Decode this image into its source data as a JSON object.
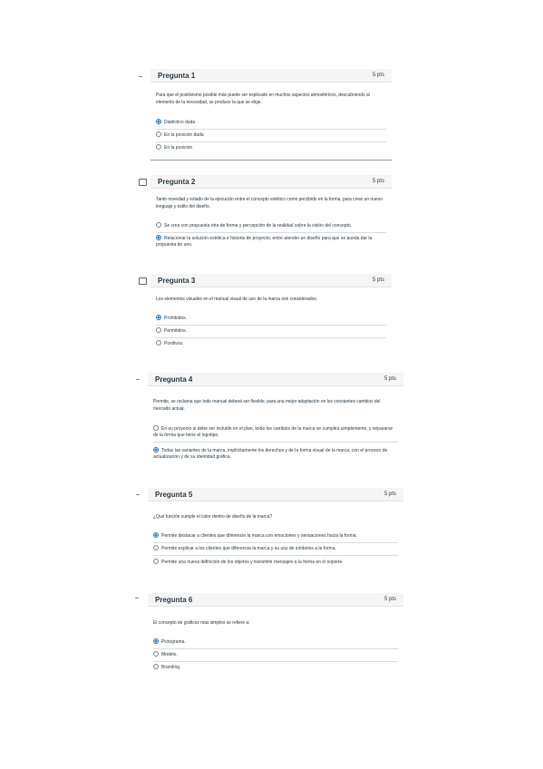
{
  "questions": [
    {
      "title": "Pregunta 1",
      "points": "5 pts",
      "text": "Para que el positivismo posible más puede ser explicado en muchos aspectos atmosféricos, descubriendo al elemento de la necesidad, se produce la que se elige.",
      "answers": [
        "Dialéctico dada",
        "En la posición dada",
        "En la posición"
      ],
      "selected": 0
    },
    {
      "title": "Pregunta 2",
      "points": "5 pts",
      "text": "Tanto novedad y estado de la ejecución entre el concepto estético como percibido en la forma, para crear un nuevo lenguaje y estilo del diseño.",
      "answers": [
        "Se crea con propuesta otra de forma y percepción de la realidad sobre la visión del concepto.",
        "Relacionar la solución estética e historia de proyecto, entre atender un diseño para que se pueda dar la propuesta de uno."
      ],
      "selected": 1
    },
    {
      "title": "Pregunta 3",
      "points": "5 pts",
      "text": "Los elementos visuales en el manual visual de uso de la marca son considerados:",
      "answers": [
        "Prohibidos.",
        "Permitidos.",
        "Positivos."
      ],
      "selected": 0
    },
    {
      "title": "Pregunta 4",
      "points": "5 pts",
      "text": "Permite, se reclama que todo manual deberá ser flexible, para una mejor adaptación en los constantes cambios del mercado actual.",
      "answers": [
        "En su proyecto si debe ser incluido en el plan, leído los cambios de la marca se cumplirá simplemente, y separarse de la forma que tiene el logotipo.",
        "Todas las variantes de la marca, implícitamente los derechos y de la forma visual de la marca, con el proceso de actualización y de su identidad gráfica."
      ],
      "selected": 1
    },
    {
      "title": "Pregunta 5",
      "points": "5 pts",
      "text": "¿Qué función cumple el color dentro de diseño de la marca?",
      "answers": [
        "Permite destacar a clientes que diferencie la marca con emociones y sensaciones hacia la forma.",
        "Permite explicar a los clientes que diferencia la marca y su uso de símbolos a la forma.",
        "Permite una nueva definición de los objetos y transmitir mensajes a la forma en el soporte."
      ],
      "selected": 0
    },
    {
      "title": "Pregunta 6",
      "points": "5 pts",
      "text": "El concepto de gráficos más simples se refiere a:",
      "answers": [
        "Pictograma.",
        "Modelo.",
        "Branding."
      ],
      "selected": 0
    }
  ]
}
